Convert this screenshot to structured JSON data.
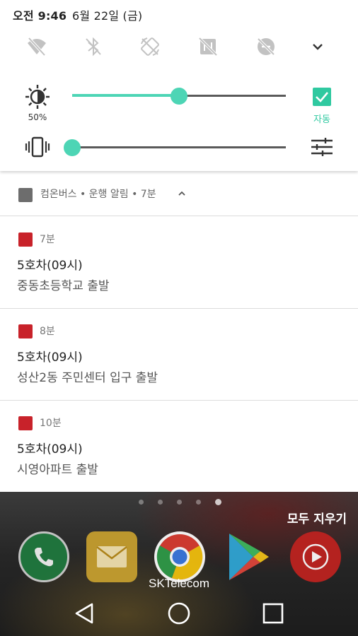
{
  "status": {
    "time": "오전 9:46",
    "date": "6월 22일 (금)"
  },
  "quick_toggles": [
    "wifi-off-icon",
    "bluetooth-off-icon",
    "rotation-lock-icon",
    "nfc-off-icon",
    "data-saver-off-icon"
  ],
  "brightness": {
    "percent_label": "50%",
    "level": 0.5,
    "auto_label": "자동",
    "auto_checked": true
  },
  "volume": {
    "level": 0.0
  },
  "notification_group": {
    "header": "컴온버스 • 운행 알림 • 7분"
  },
  "notifications": [
    {
      "time": "7분",
      "title": "5호차(09시)",
      "text": "중동초등학교 출발"
    },
    {
      "time": "8분",
      "title": "5호차(09시)",
      "text": "성산2동 주민센터 입구 출발"
    },
    {
      "time": "10분",
      "title": "5호차(09시)",
      "text": "시영아파트 출발"
    }
  ],
  "home": {
    "clear_all": "모두 지우기",
    "carrier": "SKTelecom",
    "dock_apps": [
      "phone-icon",
      "email-icon",
      "chrome-icon",
      "play-store-icon",
      "youtube-music-icon"
    ]
  },
  "colors": {
    "accent": "#4dd5b5",
    "check": "#2fc9a0",
    "app_red": "#c8222a"
  }
}
